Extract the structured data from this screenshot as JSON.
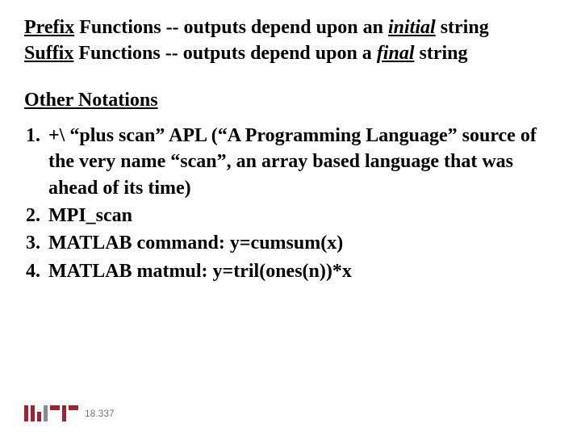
{
  "definitions": {
    "prefix": {
      "term": "Prefix",
      "functions": " Functions",
      "sep": " -- outputs depend upon an ",
      "emph": "initial",
      "tail": "  string"
    },
    "suffix": {
      "term": "Suffix",
      "functions": " Functions",
      "sep": " -- outputs depend upon a ",
      "emph": "final",
      "tail": "  string"
    }
  },
  "section_heading": "Other Notations",
  "items": [
    "+\\  “plus scan”  APL  (“A Programming Language” source of the very name “scan”, an array based language that was ahead of its time)",
    "MPI_scan",
    "MATLAB command: y=cumsum(x)",
    "MATLAB matmul: y=tril(ones(n))*x"
  ],
  "footer": {
    "course": "18.337"
  }
}
